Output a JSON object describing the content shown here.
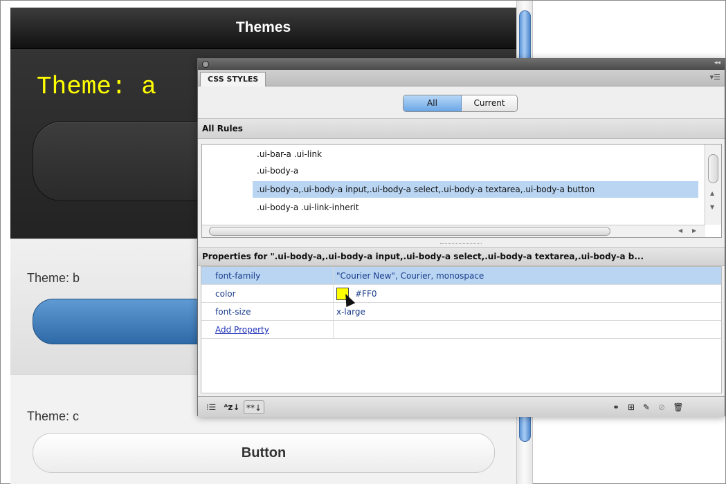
{
  "preview": {
    "header_title": "Themes",
    "theme_a_label": "Theme: a",
    "theme_b_label": "Theme: b",
    "theme_c_label": "Theme: c",
    "theme_c_button_label": "Button"
  },
  "panel": {
    "tab_label": "CSS STYLES",
    "mode_all_label": "All",
    "mode_current_label": "Current",
    "all_rules_label": "All Rules",
    "rules": [
      ".ui-bar-a .ui-link",
      ".ui-body-a",
      ".ui-body-a,.ui-body-a input,.ui-body-a select,.ui-body-a textarea,.ui-body-a button",
      ".ui-body-a .ui-link-inherit"
    ],
    "selected_rule_index": 2,
    "properties_header": "Properties for \".ui-body-a,.ui-body-a input,.ui-body-a select,.ui-body-a textarea,.ui-body-a b...",
    "properties": [
      {
        "name": "font-family",
        "value": "\"Courier New\", Courier, monospace"
      },
      {
        "name": "color",
        "value": "#FF0",
        "swatch_color": "#ffff00"
      },
      {
        "name": "font-size",
        "value": "x-large"
      },
      {
        "name": "Add Property",
        "value": ""
      }
    ],
    "selected_property_index": 0
  },
  "icons": {
    "category_view": "list-category-icon",
    "alpha_view": "sort-alpha-icon",
    "set_props": "show-set-properties-icon",
    "attach": "attach-style-sheet-icon",
    "new_rule": "new-css-rule-icon",
    "edit": "edit-rule-icon",
    "disable": "disable-property-icon",
    "delete": "trash-icon"
  },
  "colors": {
    "theme_a_text": "#ffff00",
    "selection": "#b9d5f2",
    "theme_b_button": "#2f6aa8"
  }
}
